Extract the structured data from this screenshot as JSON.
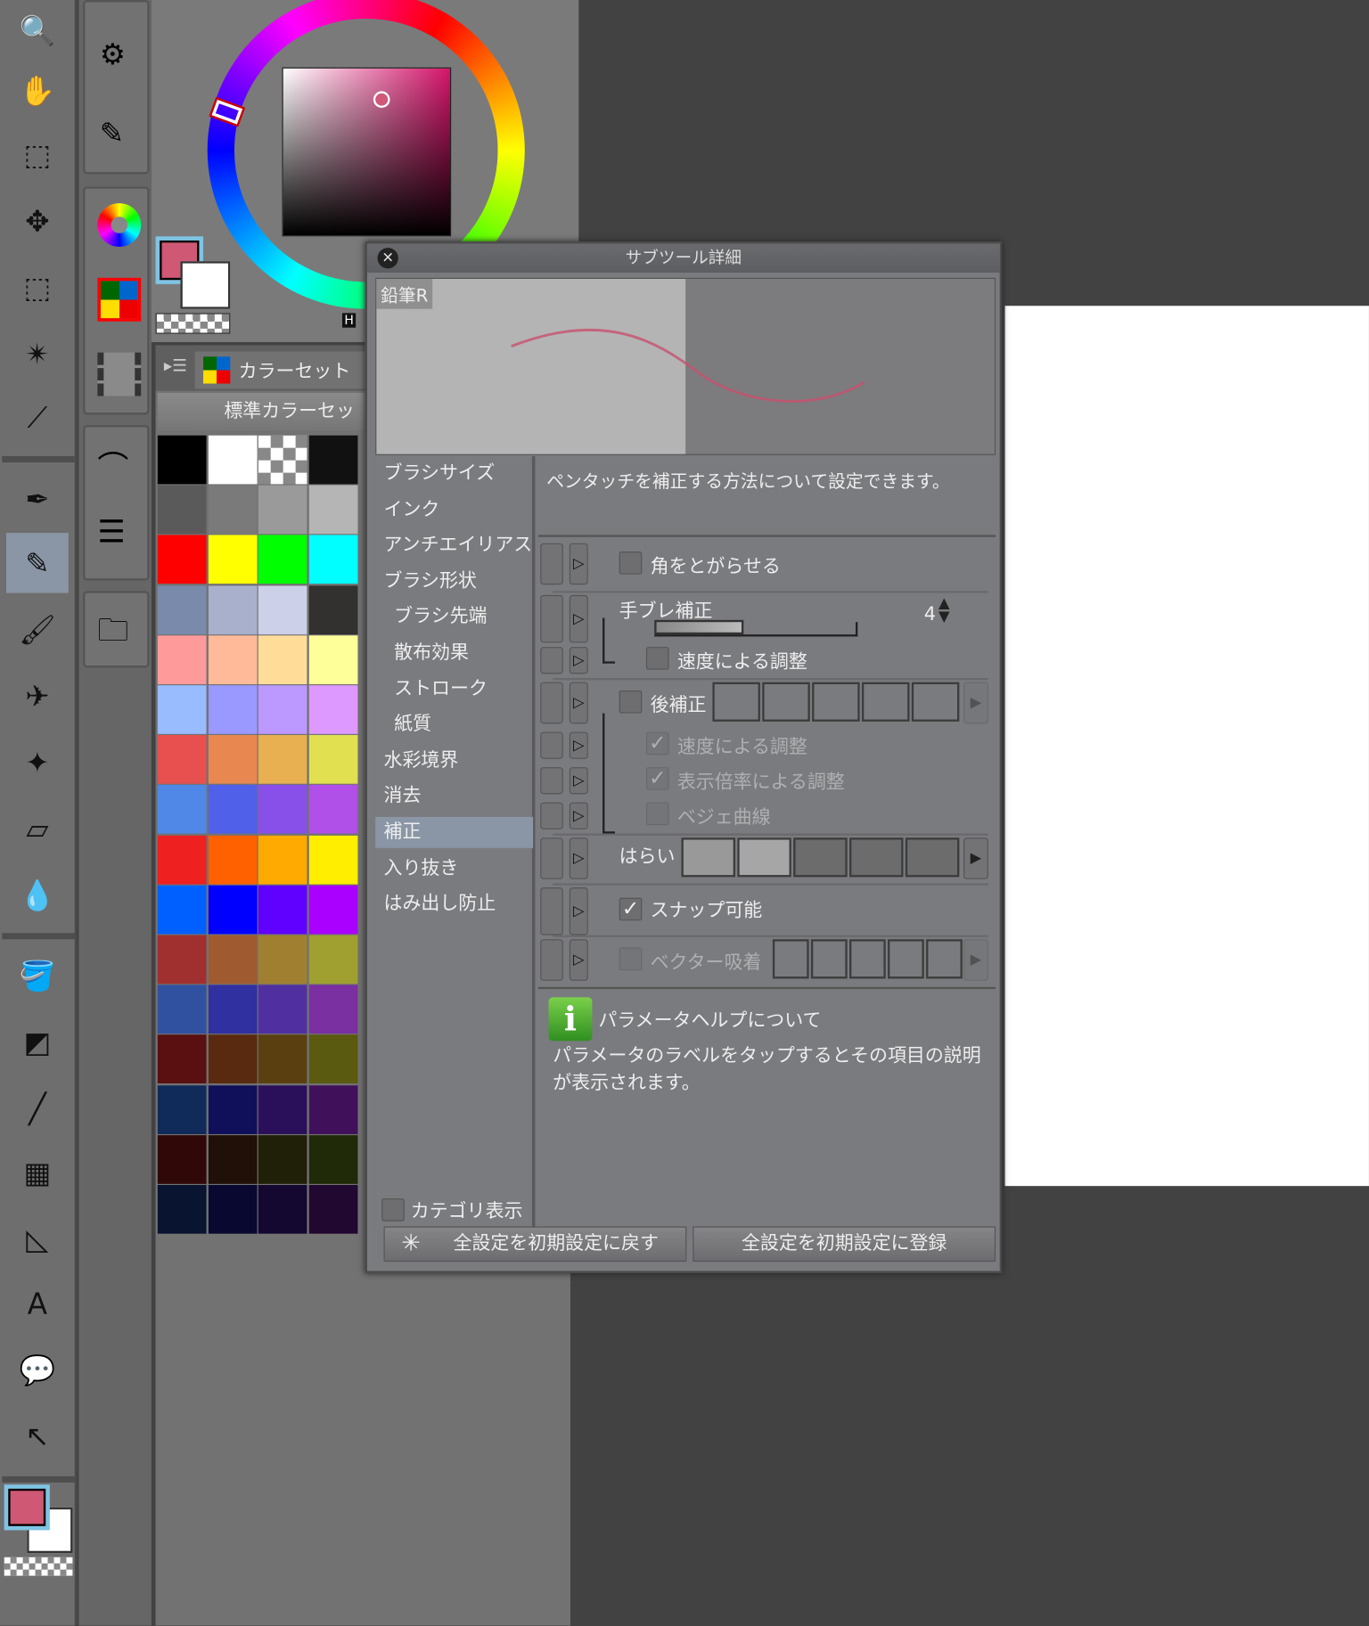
{
  "toolbar": {
    "tools": [
      {
        "name": "zoom-icon",
        "glyph": "🔍"
      },
      {
        "name": "hand-icon",
        "glyph": "✋"
      },
      {
        "name": "object-icon",
        "glyph": "⬚"
      },
      {
        "name": "move-icon",
        "glyph": "✥"
      },
      {
        "name": "marquee-icon",
        "glyph": "⬚"
      },
      {
        "name": "auto-select-icon",
        "glyph": "✴"
      },
      {
        "name": "eyedropper-icon",
        "glyph": "⟋"
      },
      {
        "name": "pen-icon",
        "glyph": "✒"
      },
      {
        "name": "pencil-icon",
        "glyph": "✎"
      },
      {
        "name": "brush-icon",
        "glyph": "🖌"
      },
      {
        "name": "airbrush-icon",
        "glyph": "✈"
      },
      {
        "name": "decoration-icon",
        "glyph": "✦"
      },
      {
        "name": "eraser-icon",
        "glyph": "▱"
      },
      {
        "name": "blend-icon",
        "glyph": "💧"
      },
      {
        "name": "fill-icon",
        "glyph": "🪣"
      },
      {
        "name": "gradient-icon",
        "glyph": "◩"
      },
      {
        "name": "figure-icon",
        "glyph": "╱"
      },
      {
        "name": "frame-icon",
        "glyph": "▦"
      },
      {
        "name": "ruler-icon",
        "glyph": "◺"
      },
      {
        "name": "text-icon",
        "glyph": "A"
      },
      {
        "name": "balloon-icon",
        "glyph": "💬"
      },
      {
        "name": "correct-line-icon",
        "glyph": "↖"
      }
    ],
    "selected": "pencil-icon",
    "main_color": "#cf5874",
    "sub_color": "#ffffff"
  },
  "color_panel": {
    "main_color": "#cf5874",
    "sub_color": "#ffffff",
    "hue_label": "H",
    "sv_hue": "#d4146a"
  },
  "color_set": {
    "tab_label": "カラーセット",
    "set_name": "標準カラーセッ",
    "swatches": [
      [
        "#000000",
        "#ffffff",
        "transparent",
        "#111111"
      ],
      [
        "#5a5a5a",
        "#7a7a7a",
        "#9a9a9a",
        "#b5b5b5"
      ],
      [
        "#ff0000",
        "#ffff00",
        "#00ff00",
        "#00ffff"
      ],
      [
        "#7a8aaa",
        "#a8b0cc",
        "#ccd0e8",
        "#333030"
      ],
      [
        "#ff9a9a",
        "#ffbb99",
        "#ffdd99",
        "#ffff99"
      ],
      [
        "#99bbff",
        "#9999ff",
        "#bb99ff",
        "#dd99ff"
      ],
      [
        "#e85050",
        "#e88850",
        "#e8b050",
        "#e0e050"
      ],
      [
        "#5088e8",
        "#5060e8",
        "#8850e8",
        "#b050e8"
      ],
      [
        "#ee2020",
        "#ff6000",
        "#ffaa00",
        "#ffee00"
      ],
      [
        "#0060ff",
        "#0000ff",
        "#6000ff",
        "#aa00ff"
      ],
      [
        "#a03030",
        "#a05a30",
        "#a08030",
        "#a0a030"
      ],
      [
        "#3050a0",
        "#3030a0",
        "#5030a0",
        "#7a30a0"
      ],
      [
        "#5a1010",
        "#5a2a10",
        "#5a4010",
        "#5a5a10"
      ],
      [
        "#102a5a",
        "#10105a",
        "#2a105a",
        "#40105a"
      ],
      [
        "#300808",
        "#201008",
        "#202008",
        "#202a08"
      ],
      [
        "#081430",
        "#080830",
        "#140830",
        "#200830"
      ]
    ]
  },
  "dialog": {
    "title": "サブツール詳細",
    "preset_name": "鉛筆R",
    "categories": [
      {
        "label": "ブラシサイズ",
        "sub": false
      },
      {
        "label": "インク",
        "sub": false
      },
      {
        "label": "アンチエイリアス",
        "sub": false
      },
      {
        "label": "ブラシ形状",
        "sub": false
      },
      {
        "label": "ブラシ先端",
        "sub": true
      },
      {
        "label": "散布効果",
        "sub": true
      },
      {
        "label": "ストローク",
        "sub": true
      },
      {
        "label": "紙質",
        "sub": true
      },
      {
        "label": "水彩境界",
        "sub": false
      },
      {
        "label": "消去",
        "sub": false
      },
      {
        "label": "補正",
        "sub": false,
        "selected": true
      },
      {
        "label": "入り抜き",
        "sub": false
      },
      {
        "label": "はみ出し防止",
        "sub": false
      }
    ],
    "category_display_label": "カテゴリ表示",
    "description": "ペンタッチを補正する方法について設定できます。",
    "settings": {
      "sharpen_corners": {
        "label": "角をとがらせる",
        "checked": false
      },
      "stabilization": {
        "label": "手ブレ補正",
        "value": "4",
        "fraction": 0.4
      },
      "stab_speed": {
        "label": "速度による調整",
        "checked": false
      },
      "post_correction": {
        "label": "後補正",
        "checked": false
      },
      "post_speed": {
        "label": "速度による調整",
        "checked": true,
        "disabled": true
      },
      "post_zoom": {
        "label": "表示倍率による調整",
        "checked": true,
        "disabled": true
      },
      "post_bezier": {
        "label": "ベジェ曲線",
        "checked": false,
        "disabled": true
      },
      "taper": {
        "label": "はらい",
        "selected_slots": 2
      },
      "snap": {
        "label": "スナップ可能",
        "checked": true
      },
      "vector_snap": {
        "label": "ベクター吸着",
        "checked": false,
        "disabled": true
      }
    },
    "help": {
      "title": "パラメータヘルプについて",
      "text": "パラメータのラベルをタップするとその項目の説明が表示されます。"
    },
    "reset_button": "全設定を初期設定に戻す",
    "register_button": "全設定を初期設定に登録"
  }
}
